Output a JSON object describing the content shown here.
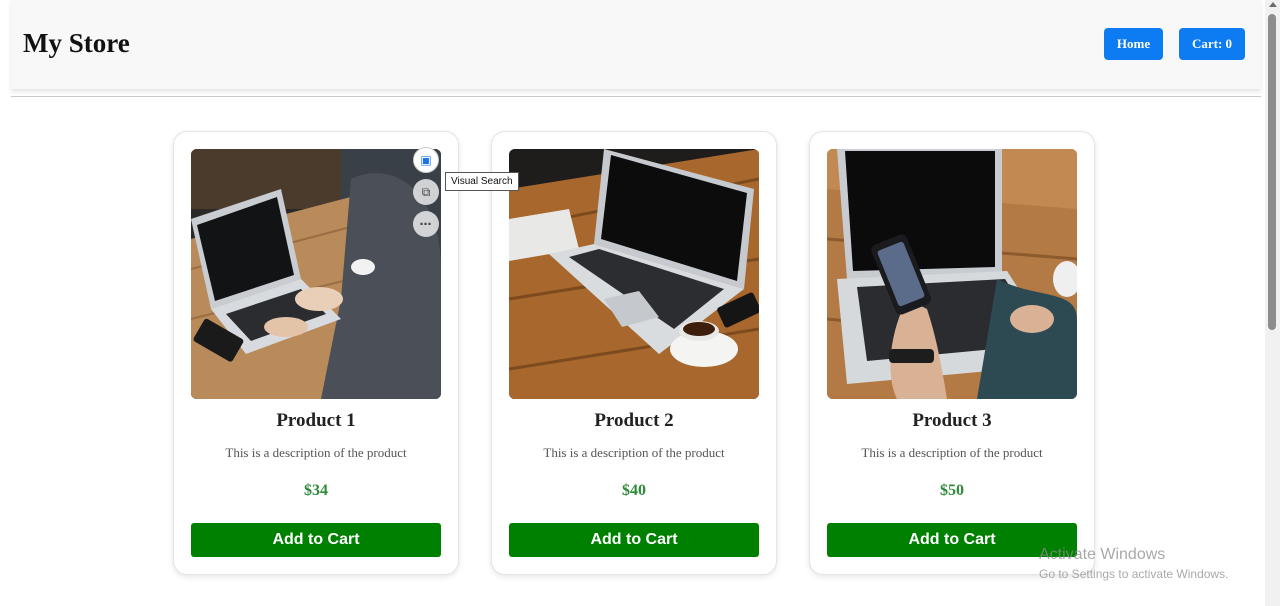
{
  "header": {
    "title": "My Store",
    "home_label": "Home",
    "cart_label": "Cart: 0"
  },
  "products": [
    {
      "name": "Product 1",
      "description": "This is a description of the product",
      "price": "$34",
      "button_label": "Add to Cart",
      "image": "laptop-typing-photo"
    },
    {
      "name": "Product 2",
      "description": "This is a description of the product",
      "price": "$40",
      "button_label": "Add to Cart",
      "image": "laptop-coffee-photo"
    },
    {
      "name": "Product 3",
      "description": "This is a description of the product",
      "price": "$50",
      "button_label": "Add to Cart",
      "image": "phone-laptop-photo"
    }
  ],
  "image_tools": {
    "tooltip": "Visual Search",
    "icons": [
      "visual-search-icon",
      "copy-image-icon",
      "more-options-icon"
    ]
  },
  "watermark": {
    "title": "Activate Windows",
    "subtitle": "Go to Settings to activate Windows."
  },
  "colors": {
    "nav_button": "#0d7cf2",
    "add_button": "#008000",
    "price": "#2e8b3a",
    "header_bg": "#f8f8f8"
  }
}
